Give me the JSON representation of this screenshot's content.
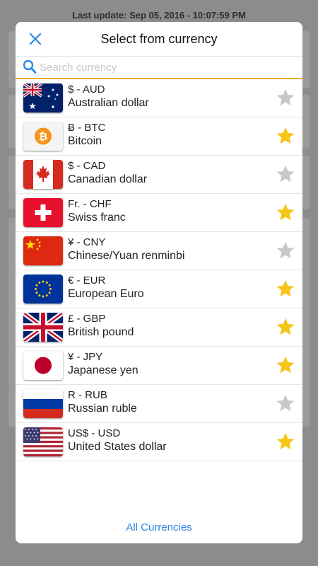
{
  "background": {
    "last_update": "Last update: Sep 05, 2016 - 10:07:59 PM"
  },
  "modal": {
    "title": "Select from currency",
    "close_icon": "close-icon",
    "search": {
      "placeholder": "Search currency",
      "value": "",
      "icon": "search-icon"
    },
    "footer_link": "All Currencies"
  },
  "colors": {
    "accent_blue": "#2b89e0",
    "search_underline": "#f0ad24",
    "star_on": "#f5c518",
    "star_off": "#c8c8c8"
  },
  "currencies": [
    {
      "code": "$ - AUD",
      "name": "Australian dollar",
      "flag": "australia-flag-icon",
      "favorite": false
    },
    {
      "code": "Ƀ - BTC",
      "name": "Bitcoin",
      "flag": "bitcoin-icon",
      "favorite": true
    },
    {
      "code": "$ - CAD",
      "name": "Canadian dollar",
      "flag": "canada-flag-icon",
      "favorite": false
    },
    {
      "code": "Fr. - CHF",
      "name": "Swiss franc",
      "flag": "switzerland-flag-icon",
      "favorite": true
    },
    {
      "code": "¥ - CNY",
      "name": "Chinese/Yuan renminbi",
      "flag": "china-flag-icon",
      "favorite": false
    },
    {
      "code": "€ - EUR",
      "name": "European Euro",
      "flag": "eu-flag-icon",
      "favorite": true
    },
    {
      "code": "£ - GBP",
      "name": "British pound",
      "flag": "uk-flag-icon",
      "favorite": true
    },
    {
      "code": "¥ - JPY",
      "name": "Japanese yen",
      "flag": "japan-flag-icon",
      "favorite": true
    },
    {
      "code": "R - RUB",
      "name": "Russian ruble",
      "flag": "russia-flag-icon",
      "favorite": false
    },
    {
      "code": "US$ - USD",
      "name": "United States dollar",
      "flag": "usa-flag-icon",
      "favorite": true
    }
  ]
}
